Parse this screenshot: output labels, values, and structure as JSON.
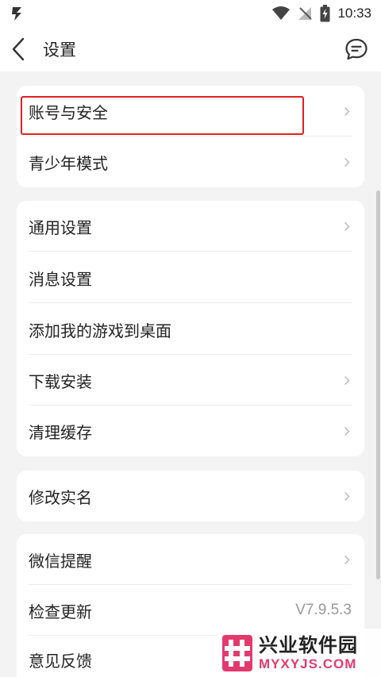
{
  "status_bar": {
    "time": "10:33",
    "icons": [
      "app-logo-icon",
      "wifi-icon",
      "no-signal-icon",
      "battery-charging-icon"
    ]
  },
  "nav": {
    "title": "设置",
    "back_icon": "back-chevron-icon",
    "message_icon": "chat-bubble-icon"
  },
  "groups": [
    {
      "items": [
        {
          "label": "账号与安全",
          "chevron": true,
          "highlighted": true
        },
        {
          "label": "青少年模式",
          "chevron": true
        }
      ]
    },
    {
      "items": [
        {
          "label": "通用设置",
          "chevron": true
        },
        {
          "label": "消息设置",
          "chevron": false
        },
        {
          "label": "添加我的游戏到桌面",
          "chevron": false
        },
        {
          "label": "下载安装",
          "chevron": true
        },
        {
          "label": "清理缓存",
          "chevron": true
        }
      ]
    },
    {
      "items": [
        {
          "label": "修改实名",
          "chevron": true
        }
      ]
    },
    {
      "items": [
        {
          "label": "微信提醒",
          "chevron": true
        },
        {
          "label": "检查更新",
          "value": "V7.9.5.3"
        },
        {
          "label": "意见反馈",
          "chevron": true
        }
      ]
    }
  ],
  "watermark": {
    "name": "兴业软件园",
    "domain": "MYXYJS.COM",
    "accent_color": "#e23a6e"
  },
  "colors": {
    "highlight_border": "#e02020",
    "background": "#f3f3f3",
    "card": "#ffffff"
  }
}
